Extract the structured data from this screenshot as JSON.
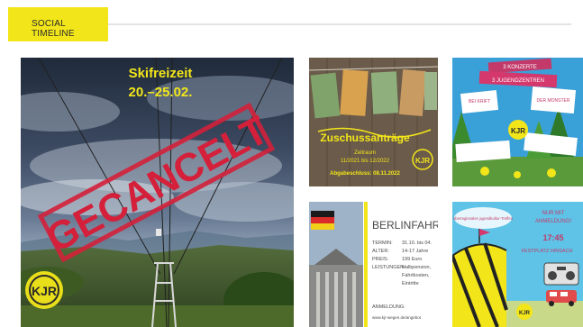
{
  "header": {
    "section_title": "SOCIAL TIMELINE"
  },
  "colors": {
    "brand_yellow": "#f2e61a",
    "cancel_red": "#d4203a",
    "rule": "#e3e3e3"
  },
  "posts": {
    "skifreizeit": {
      "title": "Skifreizeit",
      "dates": "20.–25.02.",
      "stamp": "GECANCELT",
      "logo": "KJR"
    },
    "zuschuss": {
      "title": "Zuschussanträge",
      "line1": "Zeitraum",
      "line2": "11/2021 bis 12/2022",
      "line3": "Abgabeschluss: 08.11.2022",
      "logo": "KJR"
    },
    "konzerte": {
      "banner1": "3 KONZERTE",
      "banner2": "3 JUGENDZENTREN",
      "note1": "BEI KRIFT",
      "note2": "DER MONSTER",
      "logo": "KJR"
    },
    "berlinfahrt": {
      "title": "BERLINFAHRT",
      "rows": [
        {
          "label": "TERMIN:",
          "value": "31.10. bis 04."
        },
        {
          "label": "ALTER:",
          "value": "14-17 Jahre"
        },
        {
          "label": "PREIS:",
          "value": "199 Euro"
        },
        {
          "label": "LEISTUNGEN:",
          "value": "Halbpension,"
        },
        {
          "label": "",
          "value": "Fahrtkosten,"
        },
        {
          "label": "",
          "value": "Eintritte"
        }
      ],
      "anmeldung_label": "ANMELDUNG:",
      "anmeldung_url": "www.kjr-wegen.de/angebot"
    },
    "ferienfest": {
      "left_text": "überregionales jugendkultur-Treffen",
      "right_text1": "NUR MIT",
      "right_text2": "ANMELDUNG!",
      "time": "17:45",
      "place": "FESTPLATZ HINSACH",
      "logo": "KJR"
    }
  }
}
